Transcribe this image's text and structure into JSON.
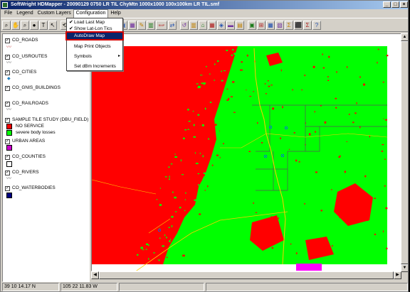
{
  "window": {
    "title": "SoftWright HDMapper - 20090129 0750 LR TIL ChyMtn 1000x1000 100x100km LR TIL.smf",
    "min": "_",
    "max": "□",
    "close": "×"
  },
  "menu": {
    "file": "File",
    "legend": "Legend",
    "custom_layers": "Custom Layers",
    "configuration": "Configuration",
    "help": "Help"
  },
  "dropdown": {
    "items": [
      "Load Last Map",
      "Show Lat-Lon Tics",
      "AutoDraw Map",
      "Map Print Objects",
      "Symbols",
      "Set dBm Increments"
    ],
    "check": "✔",
    "arrow": "▸"
  },
  "toolbar": {
    "glyphs": [
      "⌕",
      "✋",
      "⌕",
      "●",
      "T",
      "↖",
      "⟲",
      "⊕",
      "⊖",
      "⌕",
      "⎙",
      "▤",
      "▣",
      "▦",
      "✎",
      "▥",
      "BMP",
      "⇄",
      "↺",
      "▥",
      "⌂",
      "▦",
      "◈",
      "▬",
      "▤",
      "▣",
      "⊞",
      "▦",
      "▧",
      "Σ",
      "⬛",
      "Σ",
      "?"
    ]
  },
  "legend": {
    "check": "✓",
    "layers": [
      {
        "name": "CO_ROADS",
        "symbol": "〰"
      },
      {
        "name": "CO_USROUTES",
        "symbol": "〰"
      },
      {
        "name": "CO_CITIES",
        "symbol": "◆"
      },
      {
        "name": "CO_GNIS_BUILDINGS",
        "symbol": ""
      },
      {
        "name": "CO_RAILROADS",
        "symbol": "〰"
      },
      {
        "name": "SAMPLE TILE STUDY (DBU_FIELD)",
        "symbol": ""
      },
      {
        "name": "URBAN AREAS",
        "symbol": ""
      },
      {
        "name": "CO_COUNTIES",
        "symbol": ""
      },
      {
        "name": "CO_RIVERS",
        "symbol": "〰"
      },
      {
        "name": "CO_WATERBODIES",
        "symbol": ""
      }
    ],
    "study_entries": [
      {
        "label": "NO SERVICE",
        "color": "#ff0000"
      },
      {
        "label": "severe body losses",
        "color": "#00ff00"
      }
    ],
    "urban_color": "#cc00cc",
    "counties_color": "#ffffff",
    "water_color": "#000080"
  },
  "map": {
    "no_service_color": "#ff0000",
    "service_color": "#00ff00",
    "urban_color": "#ff00ff",
    "road_color": "#ffcc00",
    "county_line_color": "#555555",
    "city_color": "#0060ff"
  },
  "status": {
    "lat": "39 10 14.17 N",
    "lon": "105 22 11.83 W"
  }
}
